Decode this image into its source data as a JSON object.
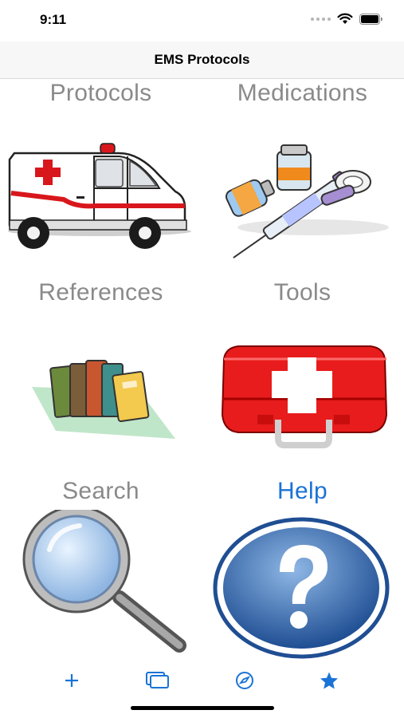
{
  "status_bar": {
    "time": "9:11"
  },
  "nav": {
    "title": "EMS Protocols"
  },
  "tiles": [
    {
      "label": "Protocols",
      "icon": "ambulance-icon"
    },
    {
      "label": "Medications",
      "icon": "medications-icon"
    },
    {
      "label": "References",
      "icon": "books-icon"
    },
    {
      "label": "Tools",
      "icon": "first-aid-kit-icon"
    },
    {
      "label": "Search",
      "icon": "magnifier-icon"
    },
    {
      "label": "Help",
      "icon": "help-icon"
    }
  ],
  "tab_bar": {
    "items": [
      {
        "icon": "plus-icon"
      },
      {
        "icon": "tabs-icon"
      },
      {
        "icon": "compass-icon"
      },
      {
        "icon": "star-icon"
      }
    ]
  },
  "colors": {
    "accent": "#1a73d6",
    "label_gray": "#8a8a8a",
    "nav_bg": "#f7f7f7"
  }
}
